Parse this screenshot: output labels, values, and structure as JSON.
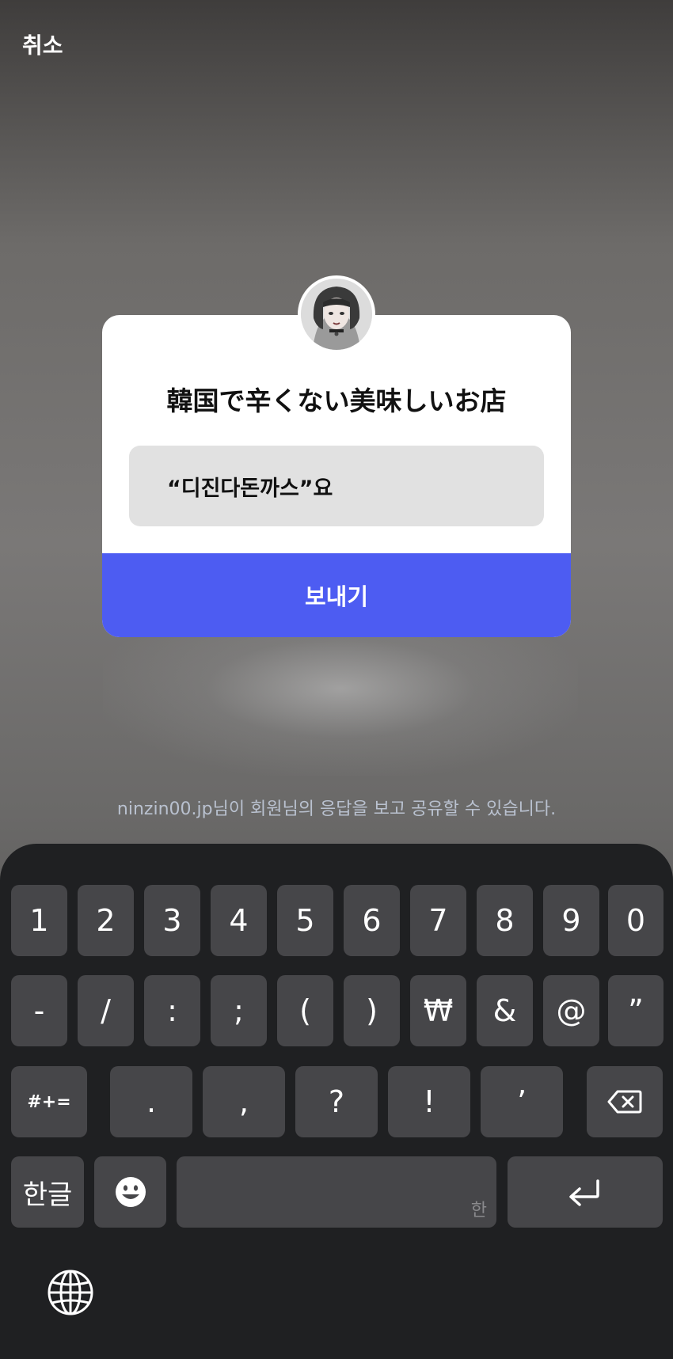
{
  "header": {
    "cancel_label": "취소"
  },
  "card": {
    "question": "韓国で辛くない美味しいお店",
    "answer": "“디진다돈까스”요",
    "send_label": "보내기"
  },
  "notice_text": "ninzin00.jp님이 회원님의 응답을 보고 공유할 수 있습니다.",
  "keyboard": {
    "row1": [
      "1",
      "2",
      "3",
      "4",
      "5",
      "6",
      "7",
      "8",
      "9",
      "0"
    ],
    "row2": [
      "-",
      "/",
      ":",
      ";",
      "(",
      ")",
      "₩",
      "&",
      "@",
      "”"
    ],
    "row3": {
      "more_symbols": "#+=",
      "keys": [
        ".",
        ",",
        "?",
        "!",
        "’"
      ]
    },
    "row4": {
      "language": "한글",
      "space_hint": "한"
    }
  },
  "colors": {
    "send_button": "#4d5cf2",
    "keyboard_bg": "#1f2022",
    "key_bg": "#464649"
  }
}
